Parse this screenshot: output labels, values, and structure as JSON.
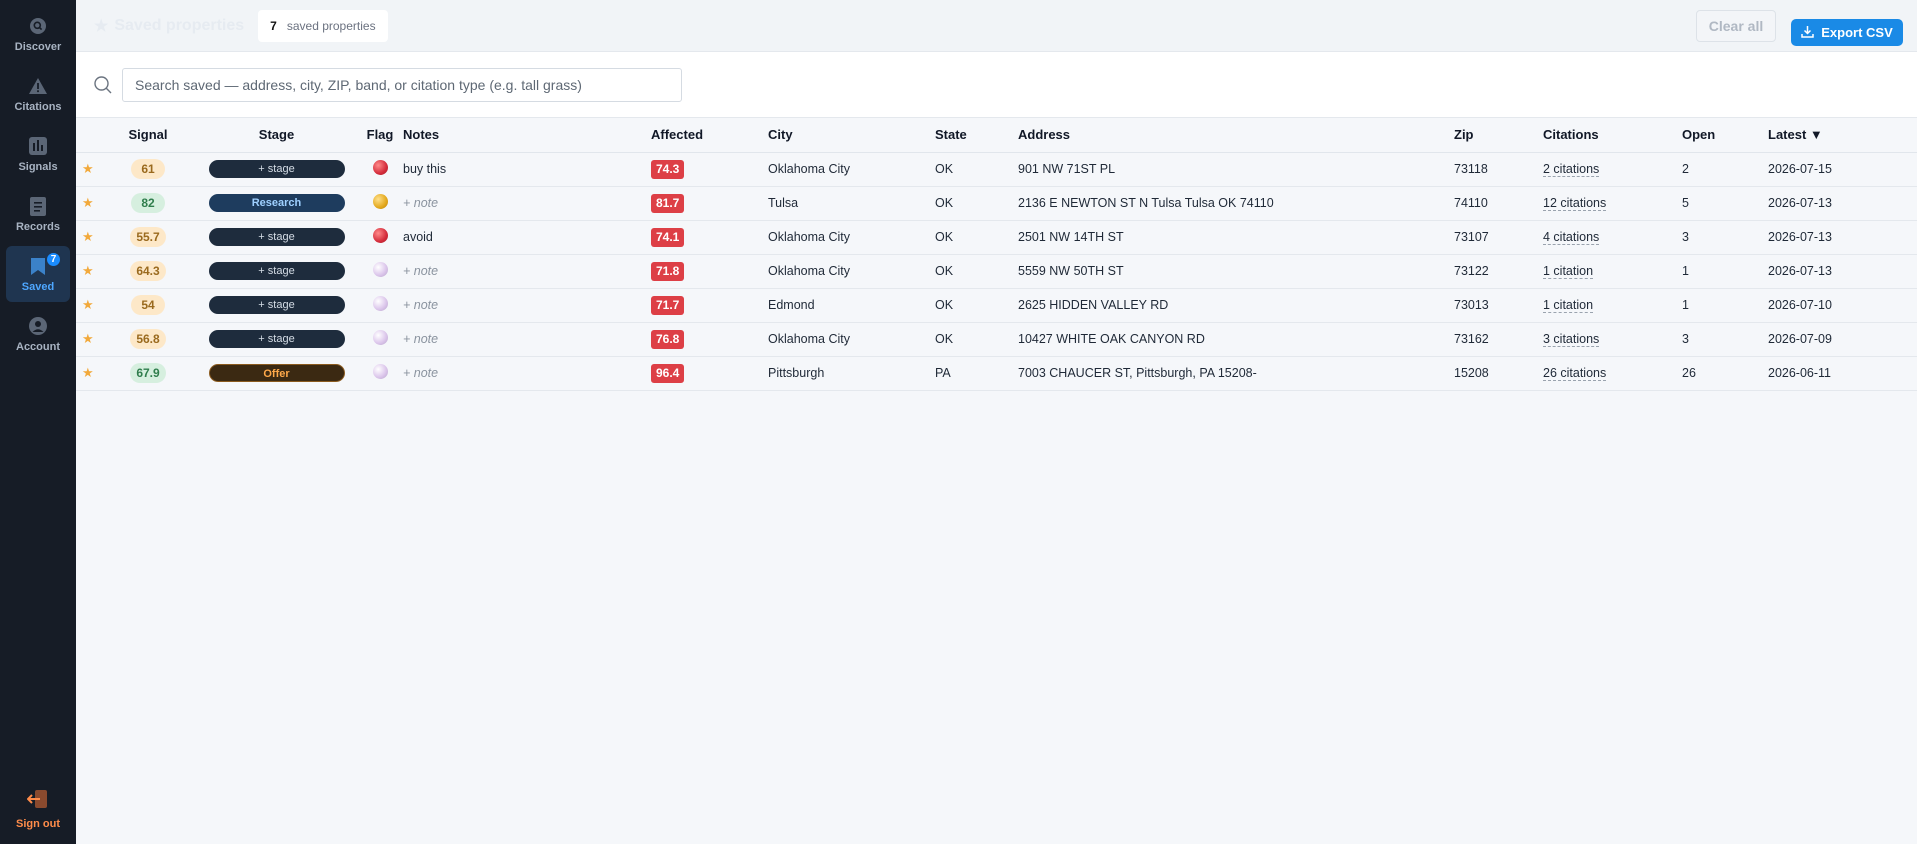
{
  "sidebar": {
    "items": [
      {
        "label": "Discover",
        "icon": "search-icon"
      },
      {
        "label": "Citations",
        "icon": "warning-icon"
      },
      {
        "label": "Signals",
        "icon": "bar-chart-icon"
      },
      {
        "label": "Records",
        "icon": "document-icon"
      },
      {
        "label": "Saved",
        "icon": "bookmark-icon",
        "badge": "7",
        "active": true
      },
      {
        "label": "Account",
        "icon": "user-icon"
      }
    ],
    "signout_label": "Sign out"
  },
  "header": {
    "title": "Saved properties",
    "count": "7",
    "count_label": "saved properties",
    "clear_label": "Clear all",
    "export_label": "Export CSV"
  },
  "search": {
    "placeholder": "Search saved — address, city, ZIP, band, or citation type (e.g. tall grass)",
    "value": ""
  },
  "table": {
    "columns": {
      "signal": "Signal",
      "stage": "Stage",
      "flag": "Flag",
      "notes": "Notes",
      "affected": "Affected",
      "city": "City",
      "state": "State",
      "address": "Address",
      "zip": "Zip",
      "citations": "Citations",
      "open": "Open",
      "latest": "Latest"
    },
    "sort_indicator": "▼",
    "rows": [
      {
        "signal": "61",
        "signal_tone": "orange",
        "stage": "+ stage",
        "stage_type": "empty",
        "flag": "red",
        "notes": "buy this",
        "affected": "74.3",
        "city": "Oklahoma City",
        "state": "OK",
        "address": "901 NW 71ST PL",
        "zip": "73118",
        "citations": "2 citations",
        "open": "2",
        "latest": "2026-07-15"
      },
      {
        "signal": "82",
        "signal_tone": "green",
        "stage": "Research",
        "stage_type": "research",
        "flag": "yellow",
        "notes": "+ note",
        "affected": "81.7",
        "city": "Tulsa",
        "state": "OK",
        "address": "2136 E NEWTON ST N Tulsa Tulsa OK 74110",
        "zip": "74110",
        "citations": "12 citations",
        "open": "5",
        "latest": "2026-07-13"
      },
      {
        "signal": "55.7",
        "signal_tone": "orange",
        "stage": "+ stage",
        "stage_type": "empty",
        "flag": "red",
        "notes": "avoid",
        "affected": "74.1",
        "city": "Oklahoma City",
        "state": "OK",
        "address": "2501 NW 14TH ST",
        "zip": "73107",
        "citations": "4 citations",
        "open": "3",
        "latest": "2026-07-13"
      },
      {
        "signal": "64.3",
        "signal_tone": "orange",
        "stage": "+ stage",
        "stage_type": "empty",
        "flag": "purple",
        "notes": "+ note",
        "affected": "71.8",
        "city": "Oklahoma City",
        "state": "OK",
        "address": "5559 NW 50TH ST",
        "zip": "73122",
        "citations": "1 citation",
        "open": "1",
        "latest": "2026-07-13"
      },
      {
        "signal": "54",
        "signal_tone": "orange",
        "stage": "+ stage",
        "stage_type": "empty",
        "flag": "purple",
        "notes": "+ note",
        "affected": "71.7",
        "city": "Edmond",
        "state": "OK",
        "address": "2625 HIDDEN VALLEY RD",
        "zip": "73013",
        "citations": "1 citation",
        "open": "1",
        "latest": "2026-07-10"
      },
      {
        "signal": "56.8",
        "signal_tone": "orange",
        "stage": "+ stage",
        "stage_type": "empty",
        "flag": "purple",
        "notes": "+ note",
        "affected": "76.8",
        "city": "Oklahoma City",
        "state": "OK",
        "address": "10427 WHITE OAK CANYON RD",
        "zip": "73162",
        "citations": "3 citations",
        "open": "3",
        "latest": "2026-07-09"
      },
      {
        "signal": "67.9",
        "signal_tone": "green",
        "stage": "Offer",
        "stage_type": "offer",
        "flag": "purple",
        "notes": "+ note",
        "affected": "96.4",
        "city": "Pittsburgh",
        "state": "PA",
        "address": "7003 CHAUCER ST, Pittsburgh, PA 15208-",
        "zip": "15208",
        "citations": "26 citations",
        "open": "26",
        "latest": "2026-06-11"
      }
    ]
  },
  "colors": {
    "sidebar_bg": "#161c26",
    "accent": "#1a8ae6",
    "affected_red": "#dd3f46",
    "star": "#f2a93b"
  }
}
